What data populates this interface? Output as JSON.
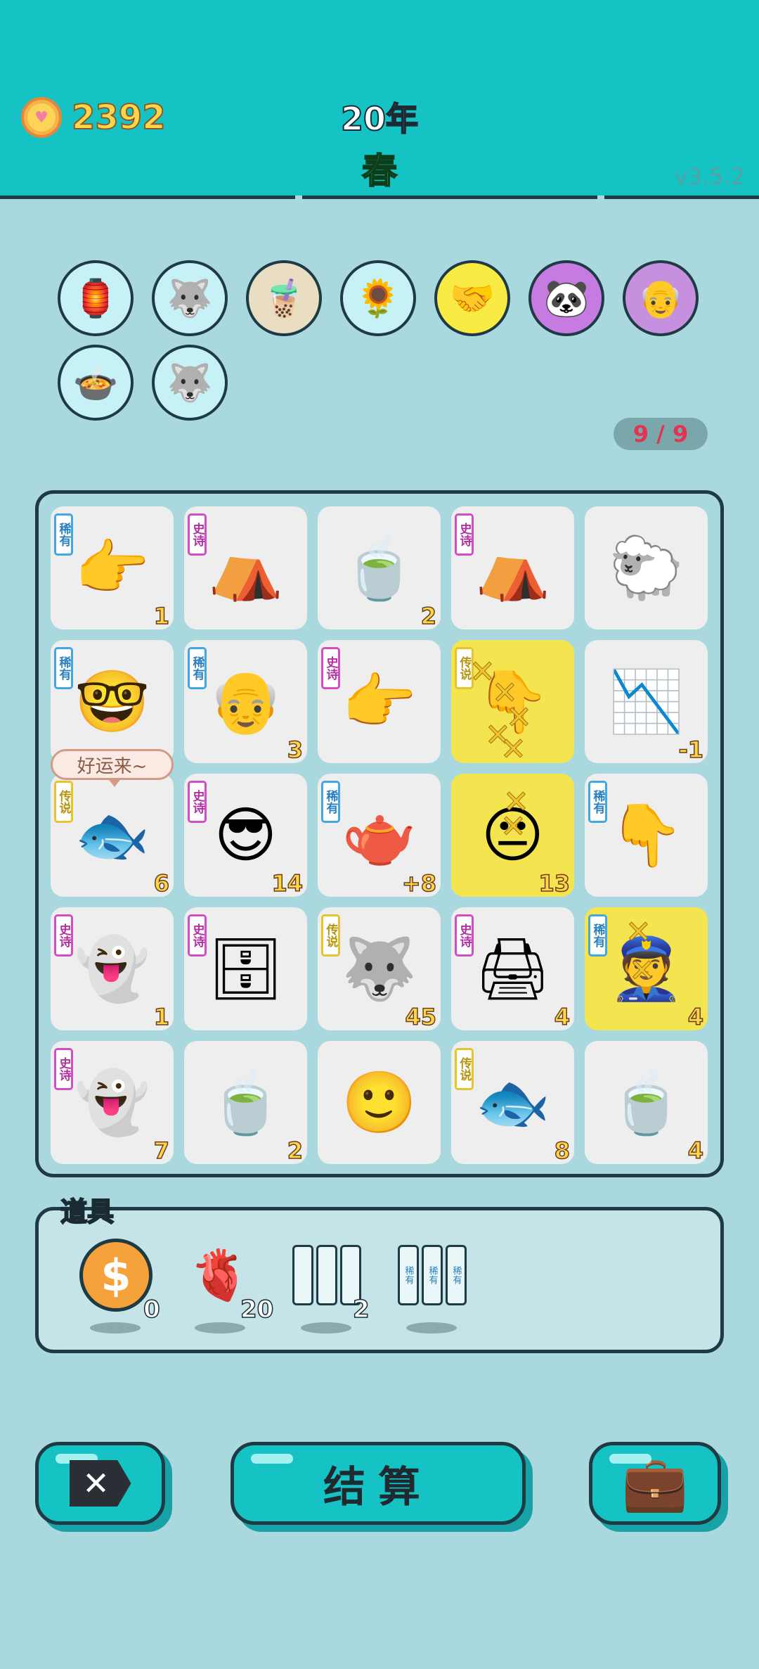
{
  "header": {
    "coins": "2392",
    "year": "20年",
    "season": "春",
    "version": "v3.5.2"
  },
  "perks": [
    {
      "name": "lantern-perk-icon",
      "glyph": "🏮"
    },
    {
      "name": "husky-heart-perk-icon",
      "glyph": "🐺"
    },
    {
      "name": "bubble-tea-perk-icon",
      "glyph": "🧋"
    },
    {
      "name": "sunflower-perk-icon",
      "glyph": "🌻"
    },
    {
      "name": "handshake-perk-icon",
      "glyph": "🤝"
    },
    {
      "name": "panda-perk-icon",
      "glyph": "🐼"
    },
    {
      "name": "math-grandpa-perk-icon",
      "glyph": "👴"
    },
    {
      "name": "rice-cooker-perk-icon",
      "glyph": "🍲"
    },
    {
      "name": "husky-heart-perk-icon",
      "glyph": "🐺"
    }
  ],
  "perk_counter": "9 / 9",
  "tags": {
    "rare": "稀有",
    "epic": "史诗",
    "legend": "传说"
  },
  "bubble_text": "好运来~",
  "tiles": [
    {
      "name": "hand-point-icon",
      "glyph": "👉",
      "tag": "稀有",
      "tagClass": "rare",
      "num": "1"
    },
    {
      "name": "rabbit-tent-icon",
      "glyph": "⛺",
      "tag": "史诗",
      "tagClass": "epic",
      "num": ""
    },
    {
      "name": "soup-bowl-icon",
      "glyph": "🍵",
      "tag": "",
      "tagClass": "",
      "num": "2"
    },
    {
      "name": "rabbit-tent-icon",
      "glyph": "⛺",
      "tag": "史诗",
      "tagClass": "epic",
      "num": ""
    },
    {
      "name": "sheep-icon",
      "glyph": "🐑",
      "tag": "",
      "tagClass": "",
      "num": ""
    },
    {
      "name": "glasses-boy-icon",
      "glyph": "🤓",
      "tag": "稀有",
      "tagClass": "rare",
      "num": ""
    },
    {
      "name": "bald-man-icon",
      "glyph": "👴",
      "tag": "稀有",
      "tagClass": "rare",
      "num": "3"
    },
    {
      "name": "grey-hand-icon",
      "glyph": "👉",
      "tag": "史诗",
      "tagClass": "epic",
      "num": ""
    },
    {
      "name": "golden-hand-icon",
      "glyph": "👇",
      "tag": "传说",
      "tagClass": "legend",
      "num": "",
      "yellow": true
    },
    {
      "name": "stock-chart-icon",
      "glyph": "📉",
      "tag": "",
      "tagClass": "",
      "num": "-1"
    },
    {
      "name": "koi-fish-icon",
      "glyph": "🐟",
      "tag": "传说",
      "tagClass": "legend",
      "num": "6"
    },
    {
      "name": "green-hat-man-icon",
      "glyph": "😎",
      "tag": "史诗",
      "tagClass": "epic",
      "num": "14"
    },
    {
      "name": "teapot-icon",
      "glyph": "🫖",
      "tag": "稀有",
      "tagClass": "rare",
      "num": "+8"
    },
    {
      "name": "chubby-man-icon",
      "glyph": "😐",
      "tag": "",
      "tagClass": "",
      "num": "13",
      "yellow": true
    },
    {
      "name": "brown-hand-icon",
      "glyph": "👇",
      "tag": "稀有",
      "tagClass": "rare",
      "num": ""
    },
    {
      "name": "ghost-icon",
      "glyph": "👻",
      "tag": "史诗",
      "tagClass": "epic",
      "num": "1"
    },
    {
      "name": "server-icon",
      "glyph": "🗄",
      "tag": "史诗",
      "tagClass": "epic",
      "num": ""
    },
    {
      "name": "husky-king-icon",
      "glyph": "🐺",
      "tag": "传说",
      "tagClass": "legend",
      "num": "45"
    },
    {
      "name": "printer-icon",
      "glyph": "🖨",
      "tag": "史诗",
      "tagClass": "epic",
      "num": "4"
    },
    {
      "name": "police-man-icon",
      "glyph": "👮",
      "tag": "稀有",
      "tagClass": "rare",
      "num": "4",
      "yellow": true
    },
    {
      "name": "ghost-icon",
      "glyph": "👻",
      "tag": "史诗",
      "tagClass": "epic",
      "num": "7"
    },
    {
      "name": "soup-bowl-icon",
      "glyph": "🍵",
      "tag": "",
      "tagClass": "",
      "num": "2"
    },
    {
      "name": "man-face-icon",
      "glyph": "🙂",
      "tag": "",
      "tagClass": "",
      "num": ""
    },
    {
      "name": "koi-fish-icon",
      "glyph": "🐟",
      "tag": "传说",
      "tagClass": "legend",
      "num": "8"
    },
    {
      "name": "tea-bag-icon",
      "glyph": "🍵",
      "tag": "",
      "tagClass": "",
      "num": "4"
    }
  ],
  "items": {
    "label": "道具",
    "list": [
      {
        "name": "coin-item",
        "count": "0"
      },
      {
        "name": "liver-item",
        "count": "20"
      },
      {
        "name": "reroll-frames-item",
        "count": "2"
      },
      {
        "name": "rare-frames-item",
        "count": ""
      }
    ]
  },
  "buttons": {
    "settle": "结算"
  }
}
